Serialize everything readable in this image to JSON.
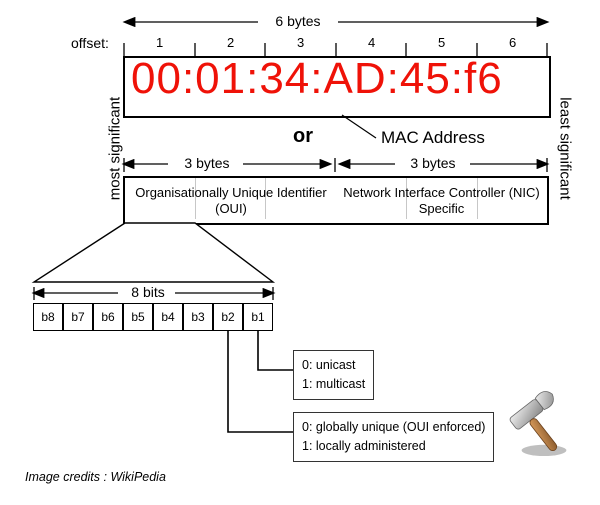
{
  "labels": {
    "offset": "offset:",
    "sixBytes": "6 bytes",
    "threeBytesA": "3 bytes",
    "threeBytesB": "3 bytes",
    "eightBits": "8 bits",
    "mostSignificant": "most significant",
    "leastSignificant": "least significant",
    "or": "or",
    "macAddress": "MAC Address",
    "credits": "Image credits : WikiPedia"
  },
  "offsets": [
    "1",
    "2",
    "3",
    "4",
    "5",
    "6"
  ],
  "mac": {
    "value": "00:01:34:AD:45:f6"
  },
  "parts": {
    "oui": "Organisationally Unique Identifier (OUI)",
    "nic": "Network Interface Controller (NIC) Specific"
  },
  "bits": [
    "b8",
    "b7",
    "b6",
    "b5",
    "b4",
    "b3",
    "b2",
    "b1"
  ],
  "bitMeanings": {
    "b1": {
      "zero": "0: unicast",
      "one": "1: multicast"
    },
    "b2": {
      "zero": "0: globally unique (OUI enforced)",
      "one": "1: locally administered"
    }
  }
}
